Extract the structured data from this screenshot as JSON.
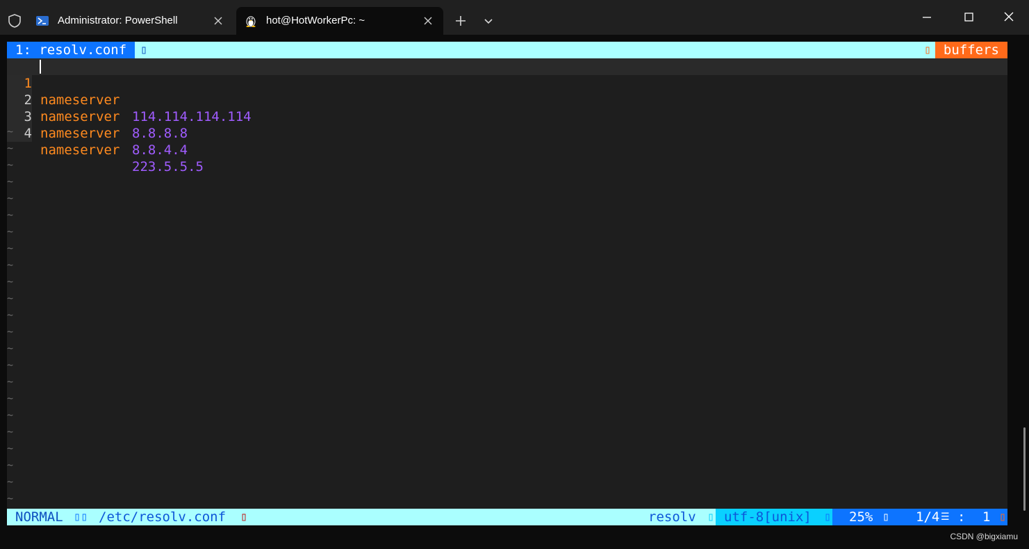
{
  "window": {
    "tabs": [
      {
        "title": "Administrator: PowerShell",
        "icon": "powershell-icon",
        "active": false
      },
      {
        "title": "hot@HotWorkerPc: ~",
        "icon": "linux-penguin-icon",
        "active": true
      }
    ]
  },
  "vim": {
    "tabline": {
      "buffer": "1: resolv.conf",
      "label": "buffers"
    },
    "lines": [
      {
        "num": "1",
        "keyword": "nameserver",
        "value": "114.114.114.114"
      },
      {
        "num": "2",
        "keyword": "nameserver",
        "value": "8.8.8.8"
      },
      {
        "num": "3",
        "keyword": "nameserver",
        "value": "8.8.4.4"
      },
      {
        "num": "4",
        "keyword": "nameserver",
        "value": "223.5.5.5"
      }
    ],
    "empty_marker": "~",
    "statusline": {
      "mode": "NORMAL",
      "path": "/etc/resolv.conf",
      "filetype": "resolv",
      "encoding": "utf-8[unix]",
      "percent": "25%",
      "position": "1/4",
      "column_sep": ":",
      "column": "1"
    }
  },
  "watermark": "CSDN @bigxiamu",
  "colors": {
    "tabline_bg": "#aaffff",
    "buffer_bg": "#0d74ff",
    "buffers_label_bg": "#ff6a1a",
    "keyword": "#ff8a1f",
    "value": "#a05cff"
  }
}
